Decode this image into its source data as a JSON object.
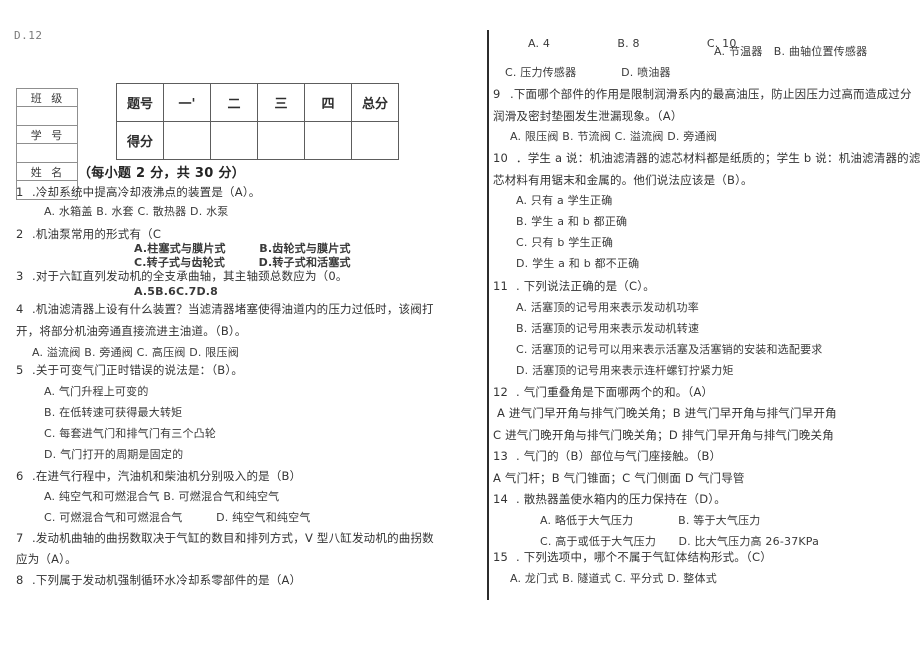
{
  "page": {
    "stray_fragment": "D.12",
    "background": "#ffffff",
    "ink_color": "#3a3a3a"
  },
  "id_table": {
    "rows": [
      {
        "label": "班 级",
        "value": ""
      },
      {
        "label": "学 号",
        "value": ""
      },
      {
        "label": "姓 名",
        "value": ""
      }
    ]
  },
  "score_table": {
    "row_labels": [
      "题号",
      "得分"
    ],
    "columns": [
      "一'",
      "二",
      "三",
      "四",
      "总分"
    ],
    "scores": [
      "",
      "",
      "",
      "",
      ""
    ]
  },
  "section_heading": "（每小题 2 分，共 30 分）",
  "left_column": [
    {
      "id": "q1",
      "num": "1",
      "text": ".冷却系统中提高冷却液沸点的装置是（A）。"
    },
    {
      "id": "q1o",
      "type": "options",
      "text": "A. 水箱盖 B. 水套 C. 散热器 D. 水泵"
    },
    {
      "id": "q2",
      "num": "2",
      "text": ".机油泵常用的形式有（C"
    },
    {
      "id": "q2o1",
      "type": "options-bold",
      "text": "A.柱塞式与膜片式　　　B.齿轮式与膜片式"
    },
    {
      "id": "q2o2",
      "type": "options-bold",
      "text": "C.转子式与齿轮式　　　D.转子式和活塞式"
    },
    {
      "id": "q3",
      "num": "3",
      "text": ".对于六缸直列发动机的全支承曲轴，其主轴颈总数应为（0。"
    },
    {
      "id": "q3o",
      "type": "options-bold",
      "text": "A.5B.6C.7D.8"
    },
    {
      "id": "q4",
      "num": "4",
      "text": ".机油滤清器上设有什么装置？当滤清器堵塞使得油道内的压力过低时，该阀打"
    },
    {
      "id": "q4b",
      "type": "cont",
      "text": "开，将部分机油旁通直接流进主油道。（B）。"
    },
    {
      "id": "q4o",
      "type": "options",
      "text": "A. 溢流阀 B. 旁通阀 C. 高压阀 D. 限压阀"
    },
    {
      "id": "q5",
      "num": "5",
      "text": ".关于可变气门正时错误的说法是：（B）。"
    },
    {
      "id": "q5a",
      "type": "options",
      "text": "A. 气门升程上可变的"
    },
    {
      "id": "q5b",
      "type": "options",
      "text": "B. 在低转速可获得最大转矩"
    },
    {
      "id": "q5c",
      "type": "options",
      "text": "C. 每套进气门和排气门有三个凸轮"
    },
    {
      "id": "q5d",
      "type": "options",
      "text": "D. 气门打开的周期是固定的"
    },
    {
      "id": "q6",
      "num": "6",
      "text": ".在进气行程中，汽油机和柴油机分别吸入的是（B）"
    },
    {
      "id": "q6a",
      "type": "options",
      "text": "A. 纯空气和可燃混合气 B. 可燃混合气和纯空气"
    },
    {
      "id": "q6b",
      "type": "options",
      "text": "C. 可燃混合气和可燃混合气　　　D. 纯空气和纯空气"
    },
    {
      "id": "q7",
      "num": "7",
      "text": ".发动机曲轴的曲拐数取决于气缸的数目和排列方式，V 型八缸发动机的曲拐数"
    },
    {
      "id": "q7b",
      "type": "cont",
      "text": "应为（A）。"
    },
    {
      "id": "q8",
      "num": "8",
      "text": ".下列属于发动机强制循环水冷却系零部件的是（A）"
    }
  ],
  "right_column": [
    {
      "id": "r-opts-top",
      "type": "options",
      "text": "A. 4　　　　　　B. 8　　　　　　C. 10"
    },
    {
      "id": "r-opts-top2",
      "type": "options",
      "text": "A. 节温器　B. 曲轴位置传感器"
    },
    {
      "id": "r-opts-top3",
      "type": "options",
      "text": "C. 压力传感器　　　　D. 喷油器"
    },
    {
      "id": "q9",
      "num": "9",
      "text": ".下面哪个部件的作用是限制润滑系内的最高油压，防止因压力过高而造成过分"
    },
    {
      "id": "q9b",
      "type": "cont",
      "text": "润滑及密封垫圈发生泄漏现象。（A）"
    },
    {
      "id": "q9o",
      "type": "options",
      "text": "A. 限压阀 B. 节流阀 C. 溢流阀 D. 旁通阀"
    },
    {
      "id": "q10",
      "num": "10",
      "text": "．学生 a 说：机油滤清器的滤芯材料都是纸质的；学生 b 说：机油滤清器的滤"
    },
    {
      "id": "q10b",
      "type": "cont",
      "text": "芯材料有用锯末和金属的。他们说法应该是（B）。"
    },
    {
      "id": "q10a",
      "type": "options",
      "text": "A. 只有 a 学生正确"
    },
    {
      "id": "q10c",
      "type": "options",
      "text": "B. 学生 a 和 b 都正确"
    },
    {
      "id": "q10d",
      "type": "options",
      "text": "C. 只有 b 学生正确"
    },
    {
      "id": "q10e",
      "type": "options",
      "text": "D. 学生 a 和 b 都不正确"
    },
    {
      "id": "q11",
      "num": "11",
      "text": ". 下列说法正确的是（C）。"
    },
    {
      "id": "q11a",
      "type": "options",
      "text": "A. 活塞顶的记号用来表示发动机功率"
    },
    {
      "id": "q11b",
      "type": "options",
      "text": "B. 活塞顶的记号用来表示发动机转速"
    },
    {
      "id": "q11c",
      "type": "options",
      "text": "C. 活塞顶的记号可以用来表示活塞及活塞销的安装和选配要求"
    },
    {
      "id": "q11d",
      "type": "options",
      "text": "D. 活塞顶的记号用来表示连杆螺钉拧紧力矩"
    },
    {
      "id": "q12",
      "num": "12",
      "text": ". 气门重叠角是下面哪两个的和。（A）"
    },
    {
      "id": "q12a",
      "type": "cont",
      "text": "A 进气门早开角与排气门晚关角；B 进气门早开角与排气门早开角"
    },
    {
      "id": "q12b",
      "type": "cont",
      "text": "C 进气门晚开角与排气门晚关角；D 排气门早开角与排气门晚关角"
    },
    {
      "id": "q13",
      "num": "13",
      "text": ". 气门的（B）部位与气门座接触。（B）"
    },
    {
      "id": "q13a",
      "type": "cont",
      "text": "A 气门杆；B 气门锥面；C 气门侧面 D 气门导管"
    },
    {
      "id": "q14",
      "num": "14",
      "text": ". 散热器盖使水箱内的压力保持在（D）。"
    },
    {
      "id": "q14a",
      "type": "options",
      "text": "A. 略低于大气压力　　　　B. 等于大气压力"
    },
    {
      "id": "q14b",
      "type": "options",
      "text": "C. 高于或低于大气压力　　D. 比大气压力高 26-37KPa"
    },
    {
      "id": "q15",
      "num": "15",
      "text": ". 下列选项中，哪个不属于气缸体结构形式。（C）"
    },
    {
      "id": "q15a",
      "type": "options",
      "text": "A. 龙门式 B. 隧道式 C. 平分式 D. 整体式"
    }
  ]
}
